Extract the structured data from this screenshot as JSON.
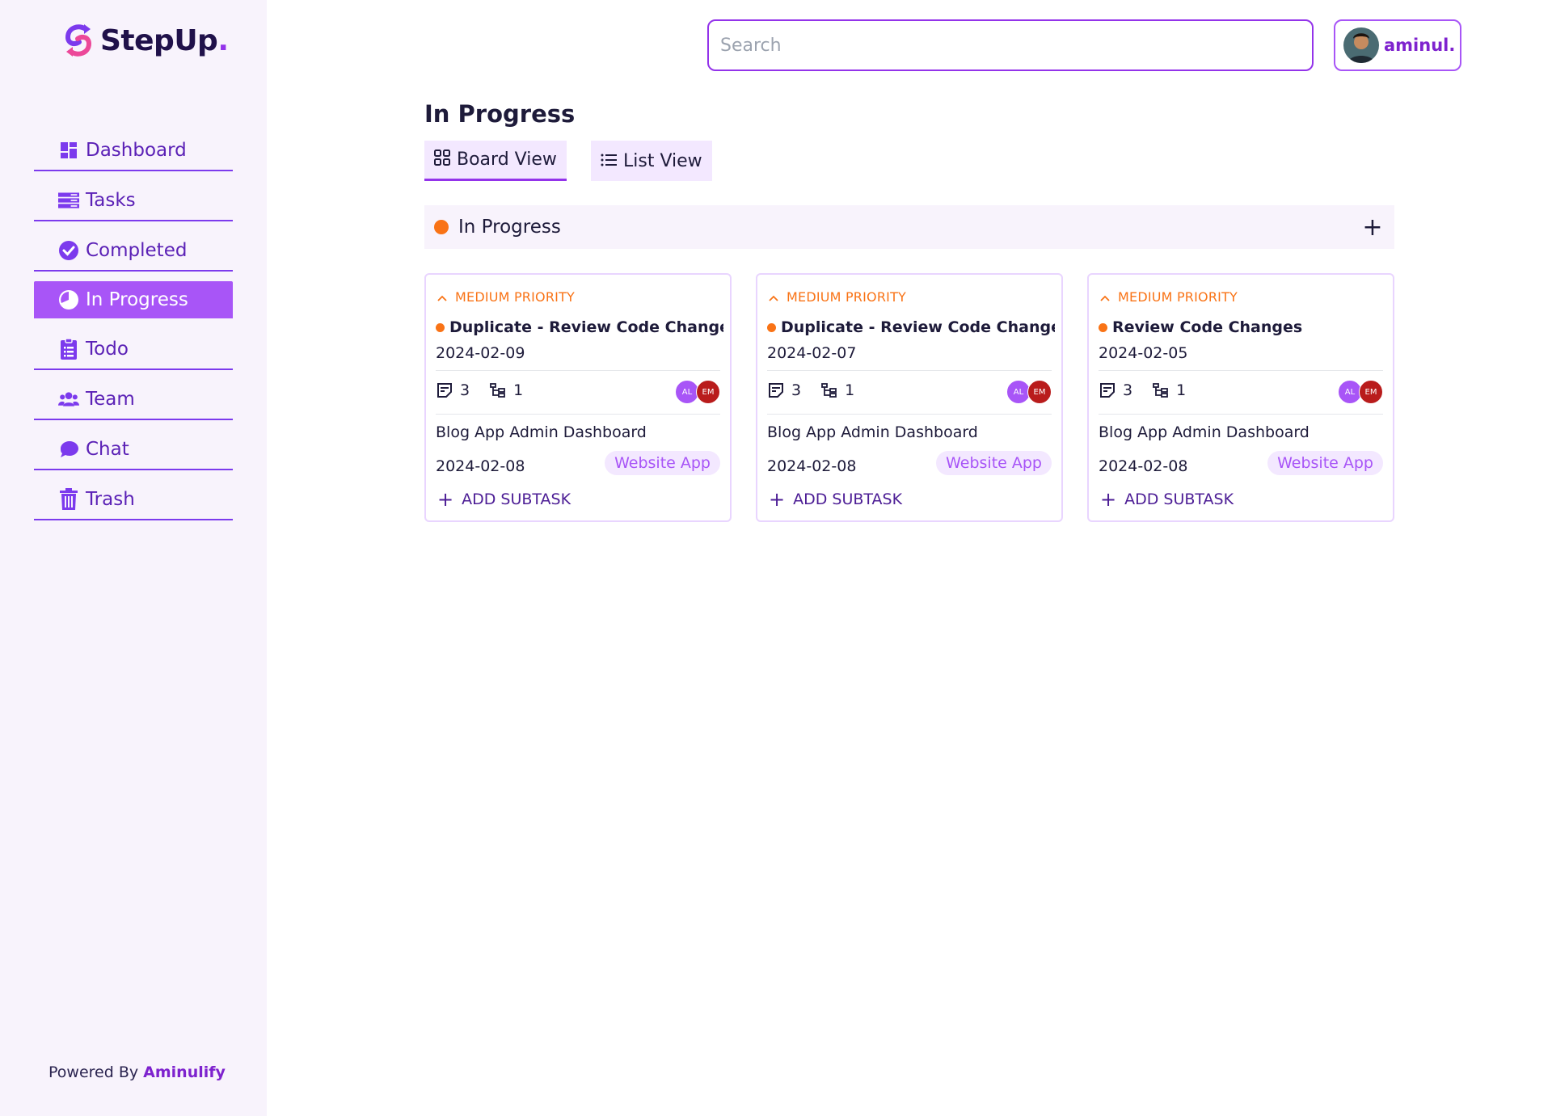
{
  "app": {
    "name": "StepUp",
    "name_dot": ".",
    "footer_prefix": "Powered By",
    "footer_brand": "Aminulify",
    "accent": "#9333ea",
    "priority_color": "#f97316"
  },
  "sidebar": {
    "items": [
      {
        "label": "Dashboard",
        "icon": "dashboard-icon"
      },
      {
        "label": "Tasks",
        "icon": "tasks-icon"
      },
      {
        "label": "Completed",
        "icon": "check-circle-icon"
      },
      {
        "label": "In Progress",
        "icon": "progress-clock-icon",
        "active": true
      },
      {
        "label": "Todo",
        "icon": "clipboard-list-icon"
      },
      {
        "label": "Team",
        "icon": "users-icon"
      },
      {
        "label": "Chat",
        "icon": "chat-bubble-icon"
      },
      {
        "label": "Trash",
        "icon": "trash-icon"
      }
    ]
  },
  "header": {
    "search_placeholder": "Search",
    "user_name": "aminul."
  },
  "main": {
    "title": "In Progress",
    "tabs": [
      {
        "label": "Board View",
        "icon": "grid-icon",
        "active": true
      },
      {
        "label": "List View",
        "icon": "list-icon"
      }
    ],
    "group": {
      "label": "In Progress",
      "add": "+"
    }
  },
  "cards": [
    {
      "priority": "MEDIUM PRIORITY",
      "title": "Duplicate - Review Code Change...",
      "date": "2024-02-09",
      "notes_count": "3",
      "subtask_count": "1",
      "assignees": [
        "AL",
        "EM"
      ],
      "project": "Blog App Admin Dashboard",
      "project_date": "2024-02-08",
      "tag": "Website App",
      "add_subtask": "ADD SUBTASK"
    },
    {
      "priority": "MEDIUM PRIORITY",
      "title": "Duplicate - Review Code Change...",
      "date": "2024-02-07",
      "notes_count": "3",
      "subtask_count": "1",
      "assignees": [
        "AL",
        "EM"
      ],
      "project": "Blog App Admin Dashboard",
      "project_date": "2024-02-08",
      "tag": "Website App",
      "add_subtask": "ADD SUBTASK"
    },
    {
      "priority": "MEDIUM PRIORITY",
      "title": "Review Code Changes",
      "date": "2024-02-05",
      "notes_count": "3",
      "subtask_count": "1",
      "assignees": [
        "AL",
        "EM"
      ],
      "project": "Blog App Admin Dashboard",
      "project_date": "2024-02-08",
      "tag": "Website App",
      "add_subtask": "ADD SUBTASK"
    }
  ]
}
